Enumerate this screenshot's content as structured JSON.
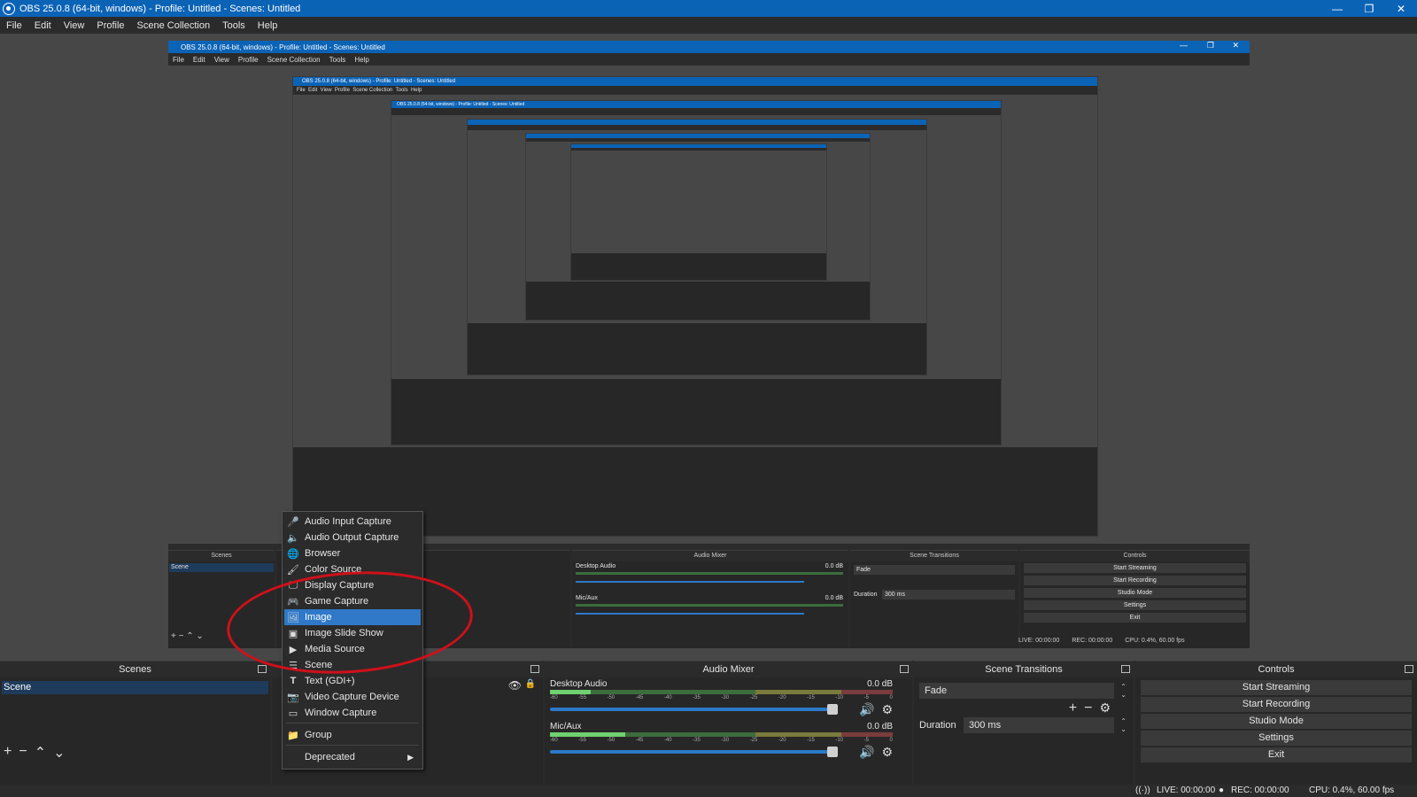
{
  "window": {
    "title": "OBS 25.0.8 (64-bit, windows) - Profile: Untitled - Scenes: Untitled",
    "minimize": "—",
    "maximize": "❐",
    "close": "✕"
  },
  "menu": [
    "File",
    "Edit",
    "View",
    "Profile",
    "Scene Collection",
    "Tools",
    "Help"
  ],
  "nested": {
    "title": "OBS 25.0.8 (64-bit, windows) - Profile: Untitled - Scenes: Untitled",
    "scenes_header": "Scenes",
    "scene_item": "Scene",
    "mixer_header": "Audio Mixer",
    "transitions_header": "Scene Transitions",
    "controls_header": "Controls",
    "desktop_audio": "Desktop Audio",
    "mic_aux": "Mic/Aux",
    "db": "0.0 dB",
    "fade": "Fade",
    "duration_label": "Duration",
    "duration_value": "300 ms",
    "btn_start_streaming": "Start Streaming",
    "btn_start_recording": "Start Recording",
    "btn_studio_mode": "Studio Mode",
    "btn_settings": "Settings",
    "btn_exit": "Exit",
    "live": "LIVE: 00:00:00",
    "rec": "REC: 00:00:00",
    "cpu": "CPU: 0.4%, 60.00 fps"
  },
  "scenes": {
    "header": "Scenes",
    "items": [
      "Scene"
    ]
  },
  "mixer": {
    "header": "Audio Mixer",
    "channels": [
      {
        "name": "Desktop Audio",
        "db": "0.0 dB"
      },
      {
        "name": "Mic/Aux",
        "db": "0.0 dB"
      }
    ],
    "ticks": [
      "-60",
      "-55",
      "-50",
      "-45",
      "-40",
      "-35",
      "-30",
      "-25",
      "-20",
      "-15",
      "-10",
      "-5",
      "0"
    ]
  },
  "transitions": {
    "header": "Scene Transitions",
    "selected": "Fade",
    "duration_label": "Duration",
    "duration_value": "300 ms"
  },
  "controls": {
    "header": "Controls",
    "buttons": [
      "Start Streaming",
      "Start Recording",
      "Studio Mode",
      "Settings",
      "Exit"
    ]
  },
  "status": {
    "live": "LIVE: 00:00:00",
    "rec": "REC: 00:00:00",
    "cpu": "CPU: 0.4%, 60.00 fps"
  },
  "context_menu": {
    "items": [
      {
        "label": "Audio Input Capture",
        "icon": "microphone-icon"
      },
      {
        "label": "Audio Output Capture",
        "icon": "speaker-icon"
      },
      {
        "label": "Browser",
        "icon": "globe-icon"
      },
      {
        "label": "Color Source",
        "icon": "brush-icon"
      },
      {
        "label": "Display Capture",
        "icon": "monitor-icon"
      },
      {
        "label": "Game Capture",
        "icon": "gamepad-icon"
      },
      {
        "label": "Image",
        "icon": "image-icon",
        "selected": true
      },
      {
        "label": "Image Slide Show",
        "icon": "slideshow-icon"
      },
      {
        "label": "Media Source",
        "icon": "play-icon"
      },
      {
        "label": "Scene",
        "icon": "list-icon"
      },
      {
        "label": "Text (GDI+)",
        "icon": "text-icon"
      },
      {
        "label": "Video Capture Device",
        "icon": "camera-icon"
      },
      {
        "label": "Window Capture",
        "icon": "window-icon"
      },
      {
        "label": "Group",
        "icon": "folder-icon"
      },
      {
        "label": "Deprecated",
        "icon": ""
      }
    ]
  },
  "colors": {
    "accent": "#0b63b6",
    "selection": "#2f79c8",
    "annotation": "#d0101a",
    "background": "#2b2b2b",
    "preview": "#474747"
  }
}
